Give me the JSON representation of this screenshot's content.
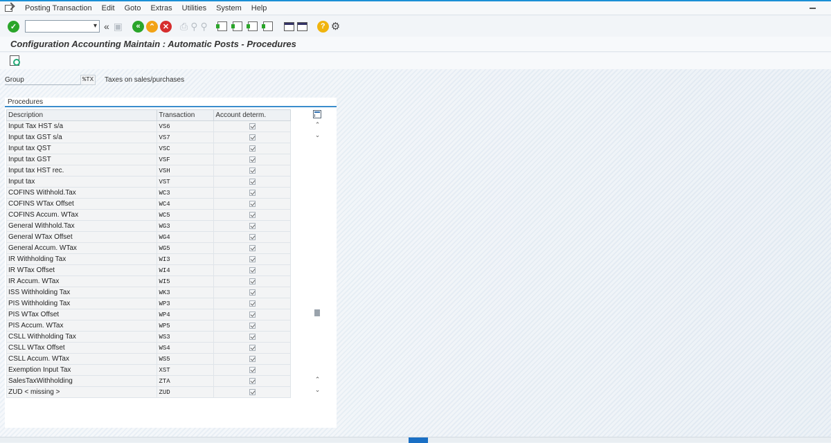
{
  "menu": {
    "items": [
      "Posting Transaction",
      "Edit",
      "Goto",
      "Extras",
      "Utilities",
      "System",
      "Help"
    ]
  },
  "toolbar": {
    "command_value": "",
    "icons": [
      "enter-icon",
      "back-double-icon",
      "save-icon",
      "back-icon",
      "exit-icon",
      "cancel-icon",
      "print-icon",
      "find-icon",
      "find-next-icon",
      "first-page-icon",
      "previous-page-icon",
      "next-page-icon",
      "last-page-icon",
      "create-session-icon",
      "shortcut-icon",
      "help-icon",
      "customize-icon"
    ]
  },
  "header": {
    "title": "Configuration Accounting Maintain : Automatic Posts - Procedures"
  },
  "group": {
    "label": "Group",
    "value": "%TX",
    "description": "Taxes on sales/purchases"
  },
  "procedures": {
    "title": "Procedures",
    "columns": [
      "Description",
      "Transaction",
      "Account determ."
    ],
    "rows": [
      {
        "description": "Input Tax HST s/a",
        "transaction": "VS6",
        "account_determ": true
      },
      {
        "description": "Input tax GST s/a",
        "transaction": "VS7",
        "account_determ": true
      },
      {
        "description": "Input tax QST",
        "transaction": "VSC",
        "account_determ": true
      },
      {
        "description": "Input tax GST",
        "transaction": "VSF",
        "account_determ": true
      },
      {
        "description": "Input tax HST rec.",
        "transaction": "VSH",
        "account_determ": true
      },
      {
        "description": "Input tax",
        "transaction": "VST",
        "account_determ": true
      },
      {
        "description": "COFINS Withhold.Tax",
        "transaction": "WC3",
        "account_determ": true
      },
      {
        "description": "COFINS WTax Offset",
        "transaction": "WC4",
        "account_determ": true
      },
      {
        "description": "COFINS Accum. WTax",
        "transaction": "WC5",
        "account_determ": true
      },
      {
        "description": "General Withhold.Tax",
        "transaction": "WG3",
        "account_determ": true
      },
      {
        "description": "General WTax Offset",
        "transaction": "WG4",
        "account_determ": true
      },
      {
        "description": "General Accum. WTax",
        "transaction": "WG5",
        "account_determ": true
      },
      {
        "description": "IR Withholding Tax",
        "transaction": "WI3",
        "account_determ": true
      },
      {
        "description": "IR WTax Offset",
        "transaction": "WI4",
        "account_determ": true
      },
      {
        "description": "IR Accum. WTax",
        "transaction": "WI5",
        "account_determ": true
      },
      {
        "description": "ISS Withholding Tax",
        "transaction": "WK3",
        "account_determ": true
      },
      {
        "description": "PIS Withholding Tax",
        "transaction": "WP3",
        "account_determ": true
      },
      {
        "description": "PIS WTax Offset",
        "transaction": "WP4",
        "account_determ": true
      },
      {
        "description": "PIS Accum. WTax",
        "transaction": "WP5",
        "account_determ": true
      },
      {
        "description": "CSLL Withholding Tax",
        "transaction": "WS3",
        "account_determ": true
      },
      {
        "description": "CSLL WTax Offset",
        "transaction": "WS4",
        "account_determ": true
      },
      {
        "description": "CSLL Accum. WTax",
        "transaction": "WS5",
        "account_determ": true
      },
      {
        "description": "Exemption Input Tax",
        "transaction": "XST",
        "account_determ": true
      },
      {
        "description": "SalesTaxWithholding",
        "transaction": "ZTA",
        "account_determ": true
      },
      {
        "description": "ZUD < missing >",
        "transaction": "ZUD",
        "account_determ": true
      }
    ]
  },
  "colors": {
    "accent": "#1a8fd6",
    "enter": "#2aa52a",
    "exit": "#f2a316",
    "cancel": "#d62e2e"
  }
}
